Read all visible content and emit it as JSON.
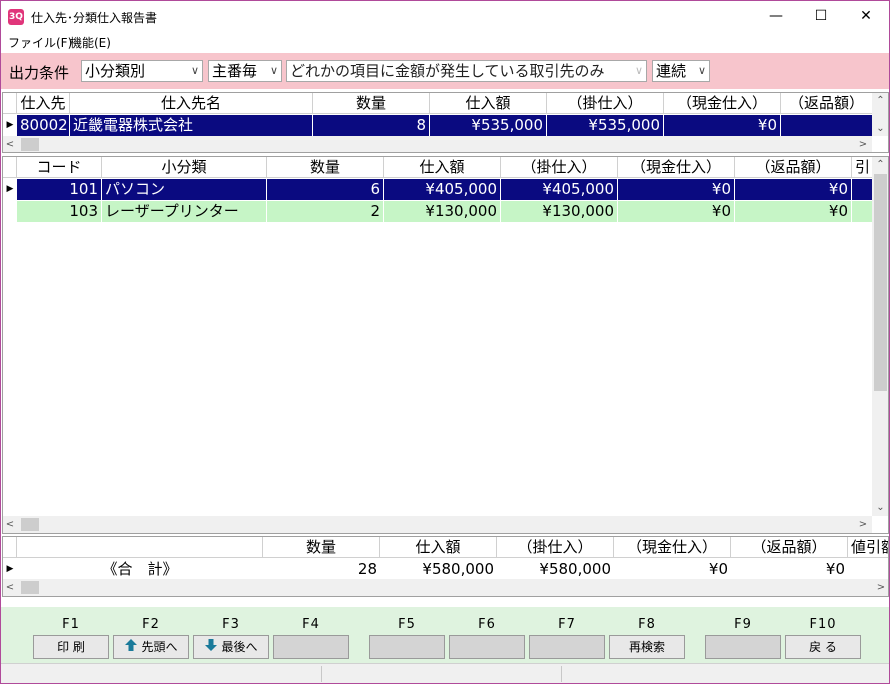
{
  "window": {
    "title": "仕入先･分類仕入報告書",
    "app_icon": "3Q",
    "minimize": "—",
    "maximize": "☐",
    "close": "✕"
  },
  "menubar": {
    "items": [
      {
        "label": "ファイル(F)"
      },
      {
        "label": "機能(E)"
      }
    ]
  },
  "conditions": {
    "label": "出力条件",
    "selects": [
      {
        "value": "小分類別",
        "arrow": "∨"
      },
      {
        "value": "主番毎",
        "arrow": "∨"
      },
      {
        "value": "どれかの項目に金額が発生している取引先のみ",
        "arrow": "∨"
      },
      {
        "value": "連続",
        "arrow": "∨"
      }
    ]
  },
  "supplier_grid": {
    "headers": [
      "仕入先",
      "仕入先名",
      "数量",
      "仕入額",
      "（掛仕入）",
      "（現金仕入）",
      "（返品額）"
    ],
    "rows": [
      [
        "80002",
        "近畿電器株式会社",
        "8",
        "¥535,000",
        "¥535,000",
        "¥0",
        ""
      ]
    ]
  },
  "category_grid": {
    "headers": [
      "コード",
      "小分類",
      "数量",
      "仕入額",
      "（掛仕入）",
      "（現金仕入）",
      "（返品額）",
      "引"
    ],
    "rows": [
      [
        "101",
        "パソコン",
        "6",
        "¥405,000",
        "¥405,000",
        "¥0",
        "¥0"
      ],
      [
        "103",
        "レーザープリンター",
        "2",
        "¥130,000",
        "¥130,000",
        "¥0",
        "¥0"
      ]
    ]
  },
  "totals_grid": {
    "headers": [
      "",
      "数量",
      "仕入額",
      "（掛仕入）",
      "（現金仕入）",
      "（返品額）",
      "値引額"
    ],
    "row": [
      "《合　計》",
      "28",
      "¥580,000",
      "¥580,000",
      "¥0",
      "¥0",
      ""
    ]
  },
  "fkeys": [
    {
      "key": "F1",
      "label": "印 刷",
      "icon": ""
    },
    {
      "key": "F2",
      "label": "先頭へ",
      "icon": "arrow-up-icon"
    },
    {
      "key": "F3",
      "label": "最後へ",
      "icon": "arrow-down-icon"
    },
    {
      "key": "F4",
      "label": "",
      "icon": ""
    },
    {
      "key": "F5",
      "label": "",
      "icon": ""
    },
    {
      "key": "F6",
      "label": "",
      "icon": ""
    },
    {
      "key": "F7",
      "label": "",
      "icon": ""
    },
    {
      "key": "F8",
      "label": "再検索",
      "icon": ""
    },
    {
      "key": "F9",
      "label": "",
      "icon": ""
    },
    {
      "key": "F10",
      "label": "戻 る",
      "icon": ""
    }
  ],
  "colors": {
    "accent_border": "#b04a9a",
    "condition_bg": "#f7c5cc",
    "selected_row": "#0a0a80",
    "alt_row": "#c6f5c6",
    "fkey_bar": "#dff3df"
  }
}
